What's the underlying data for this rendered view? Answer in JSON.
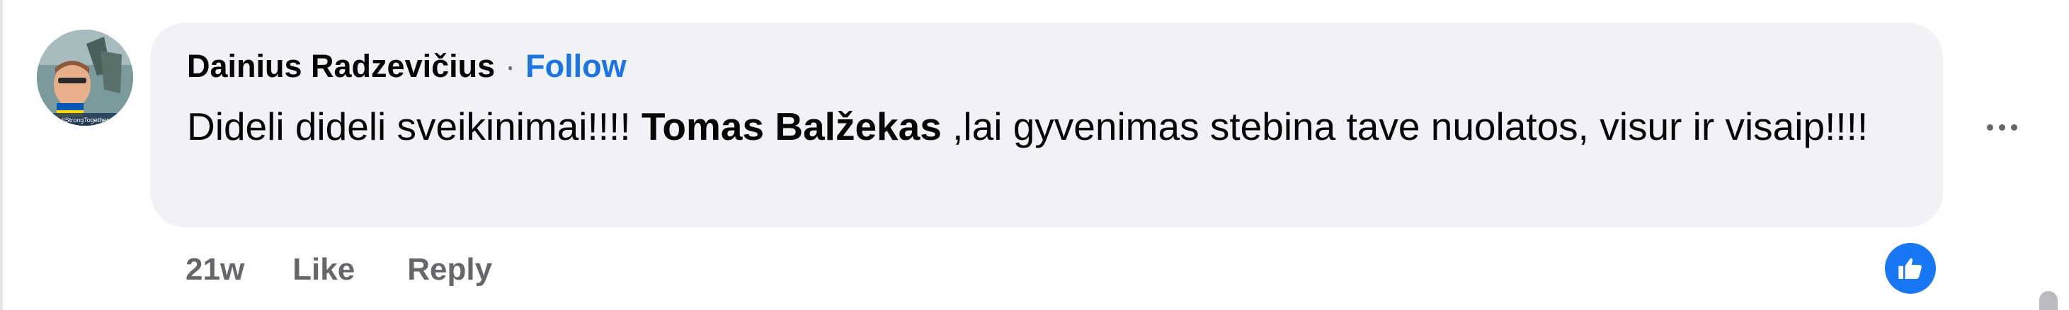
{
  "comment": {
    "author": "Dainius Radzevičius",
    "separator": "·",
    "follow_label": "Follow",
    "text_before_mention": "Dideli dideli sveikinimai!!!! ",
    "mention": "Tomas Balžekas",
    "text_after_mention": " ,lai gyvenimas stebina tave nuolatos, visur ir visaip!!!!",
    "avatar_badge_text": "#StrongTogether",
    "more_icon": "ellipsis-horizontal-icon"
  },
  "actions": {
    "timestamp": "21w",
    "like_label": "Like",
    "reply_label": "Reply"
  },
  "reactions": {
    "icon": "thumbs-up-icon",
    "color": "#1877f2"
  },
  "colors": {
    "bubble_bg": "#f0f2f5",
    "follow_link": "#1b74e4",
    "secondary_text": "#65676b",
    "primary_text": "#050505"
  }
}
